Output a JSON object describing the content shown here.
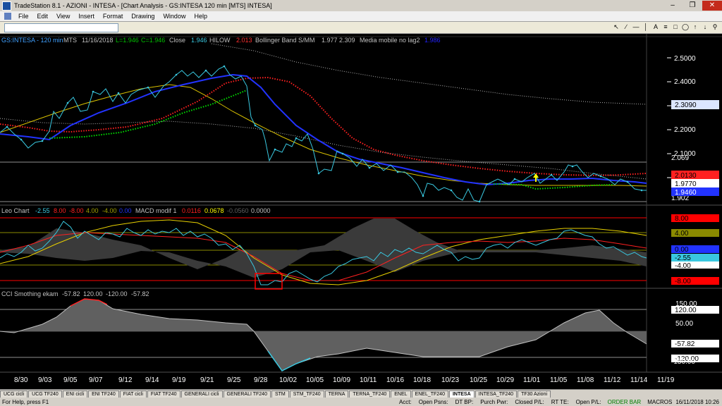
{
  "window": {
    "title": "TradeStation 8.1 - AZIONI - INTESA - [Chart Analysis - GS:INTESA  120 min  [MTS] INTESA]",
    "controls": [
      "minimize-icon",
      "restore-icon",
      "close-icon"
    ]
  },
  "menu": {
    "items": [
      "File",
      "Edit",
      "View",
      "Insert",
      "Format",
      "Drawing",
      "Window",
      "Help"
    ]
  },
  "panel1": {
    "header": {
      "symbol": "GS:INTESA - 120 min",
      "exchange": "MTS",
      "date": "11/16/2018",
      "low": "L=1.946",
      "close": "C=1.946",
      "close_label": "Close",
      "close_val": "1.946",
      "hilow_label": "HILOW",
      "hilow_val": "2.013",
      "boll_label": "Bollinger Band S/MM",
      "boll_v1": "1.977",
      "boll_v2": "2.309",
      "mm_label": "Media mobile no lag2",
      "mm_val": "1.986"
    },
    "y_labels": [
      "2.5000",
      "2.4000",
      "2.3000",
      "2.2000",
      "2.1000",
      "2.0000",
      "1.9000"
    ],
    "level_labels": {
      "high_line": "2.069",
      "low_line": "1.902"
    },
    "price_boxes": {
      "upper_band": "2.3090",
      "hilow": "2.0130",
      "mid_band": "1.9770",
      "last": "1.9460"
    }
  },
  "panel2": {
    "header": {
      "name": "Leo Chart",
      "v1": "-2.55",
      "v2": "8.00",
      "v3": "-8.00",
      "v4": "4.00",
      "v5": "-4.00",
      "v6": "0.00",
      "macd_label": "MACD modif 1",
      "m1": "0.0116",
      "m2": "0.0678",
      "m3": "-0.0560",
      "m4": "0.0000"
    },
    "axis_boxes": {
      "p8": "8.00",
      "p4": "4.00",
      "zero": "0.00",
      "cur": "-2.55",
      "m4": "-4.00",
      "m8": "-8.00"
    }
  },
  "panel3": {
    "header": {
      "name": "CCI Smothing ekam",
      "v1": "-57.82",
      "v2": "120.00",
      "v3": "-120.00",
      "v4": "-57.82"
    },
    "axis": {
      "a150": "150.00",
      "a120": "120.00",
      "a50": "50.00",
      "cur": "-57.82",
      "m120": "-120.00",
      "m150": "-150.00"
    }
  },
  "x_axis": {
    "labels": [
      "8/30",
      "9/03",
      "9/05",
      "9/07",
      "9/12",
      "9/14",
      "9/19",
      "9/21",
      "9/25",
      "9/28",
      "10/02",
      "10/05",
      "10/09",
      "10/11",
      "10/16",
      "10/18",
      "10/23",
      "10/25",
      "10/29",
      "11/01",
      "11/05",
      "11/08",
      "11/12",
      "11/14",
      "11/19"
    ]
  },
  "sheet_tabs": {
    "items": [
      "UCG cicli",
      "UCG TF240",
      "ENI cicli",
      "ENI TF240",
      "FIAT cicli",
      "FIAT TF240",
      "GENERALI cicli",
      "GENERALI TF240",
      "STM",
      "STM_TF240",
      "TERNA",
      "TERNA_TF240",
      "ENEL",
      "ENEL_TF240",
      "INTESA",
      "INTESA_TF240",
      "TF30 Azioni"
    ],
    "active": "INTESA"
  },
  "status": {
    "help": "For Help, press F1",
    "acct": "Acct:",
    "open_psns": "Open Psns:",
    "dt_bp": "DT BP:",
    "purch_pwr": "Purch Pwr:",
    "closed_pl": "Closed P/L:",
    "rt_te": "RT TE:",
    "open_pl": "Open P/L:",
    "order_bar": "ORDER BAR",
    "macros": "MACROS",
    "datetime": "16/11/2018 10:26"
  },
  "colors": {
    "price": "#39c8e0",
    "bb_mid": "#2222ff",
    "bb_upper": "#c0c0c0",
    "hilow": "#ff2020",
    "green_dots": "#00e000",
    "yellow": "#e8d000",
    "red_level": "#ff0000",
    "olive_level": "#8a8a00"
  }
}
